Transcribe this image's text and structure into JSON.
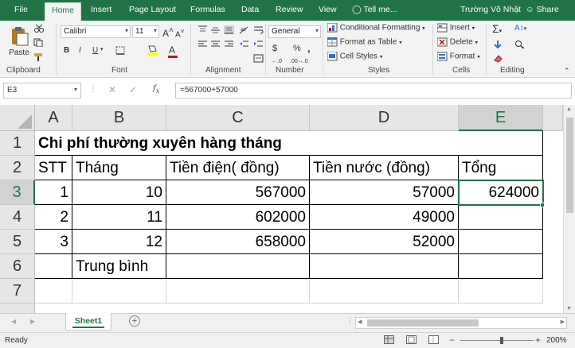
{
  "ribbon_tabs": [
    "File",
    "Home",
    "Insert",
    "Page Layout",
    "Formulas",
    "Data",
    "Review",
    "View"
  ],
  "tell_me": "Tell me...",
  "user_name": "Trường Võ Nhật",
  "share_label": "Share",
  "clipboard": {
    "paste_label": "Paste",
    "group_label": "Clipboard"
  },
  "font": {
    "name": "Calibri",
    "size": "11",
    "grow_label": "A",
    "shrink_label": "A",
    "bold": "B",
    "italic": "I",
    "underline": "U",
    "color_letter": "A",
    "group_label": "Font"
  },
  "alignment": {
    "group_label": "Alignment"
  },
  "number": {
    "format": "General",
    "currency": "$",
    "percent": "%",
    "comma": ",",
    "dec_inc": "←.0",
    "dec_dec": ".00→.0",
    "group_label": "Number"
  },
  "styles": {
    "conditional": "Conditional Formatting",
    "format_table": "Format as Table",
    "cell_styles": "Cell Styles",
    "group_label": "Styles"
  },
  "cells": {
    "insert": "Insert",
    "delete": "Delete",
    "format": "Format",
    "group_label": "Cells"
  },
  "editing": {
    "group_label": "Editing"
  },
  "name_box": "E3",
  "formula": "=567000+57000",
  "columns": [
    "A",
    "B",
    "C",
    "D",
    "E"
  ],
  "rows": [
    "1",
    "2",
    "3",
    "4",
    "5",
    "6",
    "7"
  ],
  "cells_data": {
    "title": "Chi phí thường xuyên hàng tháng",
    "headers": [
      "STT",
      "Tháng",
      "Tiền điện( đồng)",
      "Tiền nước (đồng)",
      "Tổng"
    ],
    "r3": [
      "1",
      "10",
      "567000",
      "57000",
      "624000"
    ],
    "r4": [
      "2",
      "11",
      "602000",
      "49000",
      ""
    ],
    "r5": [
      "3",
      "12",
      "658000",
      "52000",
      ""
    ],
    "r6_b": "Trung bình"
  },
  "sheet_name": "Sheet1",
  "status": "Ready",
  "zoom": "200%",
  "colors": {
    "excel_green": "#217346"
  }
}
